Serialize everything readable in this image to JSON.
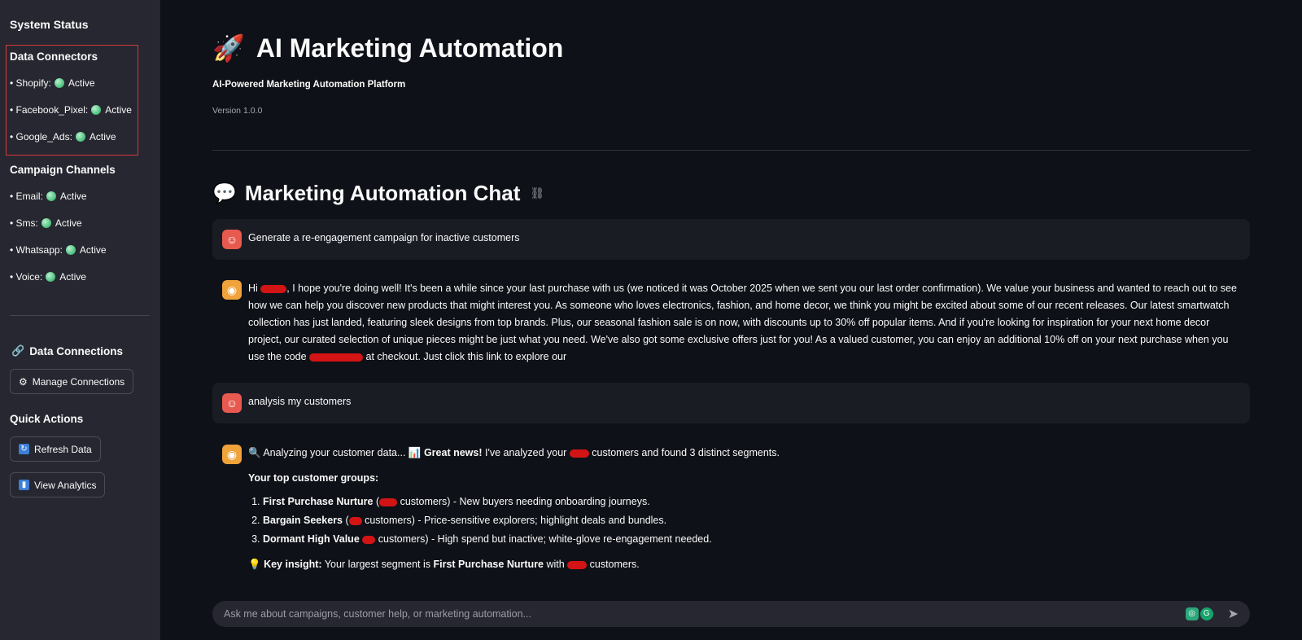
{
  "sidebar": {
    "system_status": "System Status",
    "data_connectors": {
      "heading": "Data Connectors",
      "items": [
        {
          "name": "• Shopify:",
          "status": "Active"
        },
        {
          "name": "• Facebook_Pixel:",
          "status": "Active"
        },
        {
          "name": "• Google_Ads:",
          "status": "Active"
        }
      ]
    },
    "campaign_channels": {
      "heading": "Campaign Channels",
      "items": [
        {
          "name": "• Email:",
          "status": "Active"
        },
        {
          "name": "• Sms:",
          "status": "Active"
        },
        {
          "name": "• Whatsapp:",
          "status": "Active"
        },
        {
          "name": "• Voice:",
          "status": "Active"
        }
      ]
    },
    "data_connections": {
      "heading": "Data Connections",
      "button": "Manage Connections"
    },
    "quick_actions": {
      "heading": "Quick Actions",
      "refresh": "Refresh Data",
      "analytics": "View Analytics"
    }
  },
  "header": {
    "icon": "🚀",
    "title": "AI Marketing Automation",
    "subtitle": "AI-Powered Marketing Automation Platform",
    "version": "Version 1.0.0"
  },
  "chat": {
    "icon": "💬",
    "title": "Marketing Automation Chat",
    "messages": {
      "user1": "Generate a re-engagement campaign for inactive customers",
      "assistant1": {
        "p1": "Hi ",
        "p2": ", I hope you're doing well! It's been a while since your last purchase with us (we noticed it was October 2025 when we sent you our last order confirmation). We value your business and wanted to reach out to see how we can help you discover new products that might interest you. As someone who loves electronics, fashion, and home decor, we think you might be excited about some of our recent releases. Our latest smartwatch collection has just landed, featuring sleek designs from top brands. Plus, our seasonal fashion sale is on now, with discounts up to 30% off popular items. And if you're looking for inspiration for your next home decor project, our curated selection of unique pieces might be just what you need. We've also got some exclusive offers just for you! As a valued customer, you can enjoy an additional 10% off on your next purchase when you use the code ",
        "p3": " at checkout. Just click this link to explore our"
      },
      "user2": "analysis my customers",
      "assistant2": {
        "intro1": "🔍 Analyzing your customer data... 📊 ",
        "intro_bold": "Great news!",
        "intro2": " I've analyzed your ",
        "intro3": " customers and found 3 distinct segments.",
        "groups_heading": "Your top customer groups:",
        "groups": [
          {
            "name": "First Purchase Nurture",
            "open": " (",
            "close": " customers) - New buyers needing onboarding journeys."
          },
          {
            "name": "Bargain Seekers",
            "open": " (",
            "close": " customers) - Price-sensitive explorers; highlight deals and bundles."
          },
          {
            "name": "Dormant High Value",
            "open": " ",
            "close": " customers) - High spend but inactive; white-glove re-engagement needed."
          }
        ],
        "insight_icon": "💡",
        "insight_label": "Key insight:",
        "insight_text1": " Your largest segment is ",
        "insight_bold": "First Purchase Nurture",
        "insight_text2": " with ",
        "insight_text3": " customers."
      }
    },
    "input_placeholder": "Ask me about campaigns, customer help, or marketing automation..."
  },
  "colors": {
    "background": "#0e1117",
    "sidebar": "#262730",
    "active_dot": "#5ec98b",
    "redaction": "#d31414"
  }
}
